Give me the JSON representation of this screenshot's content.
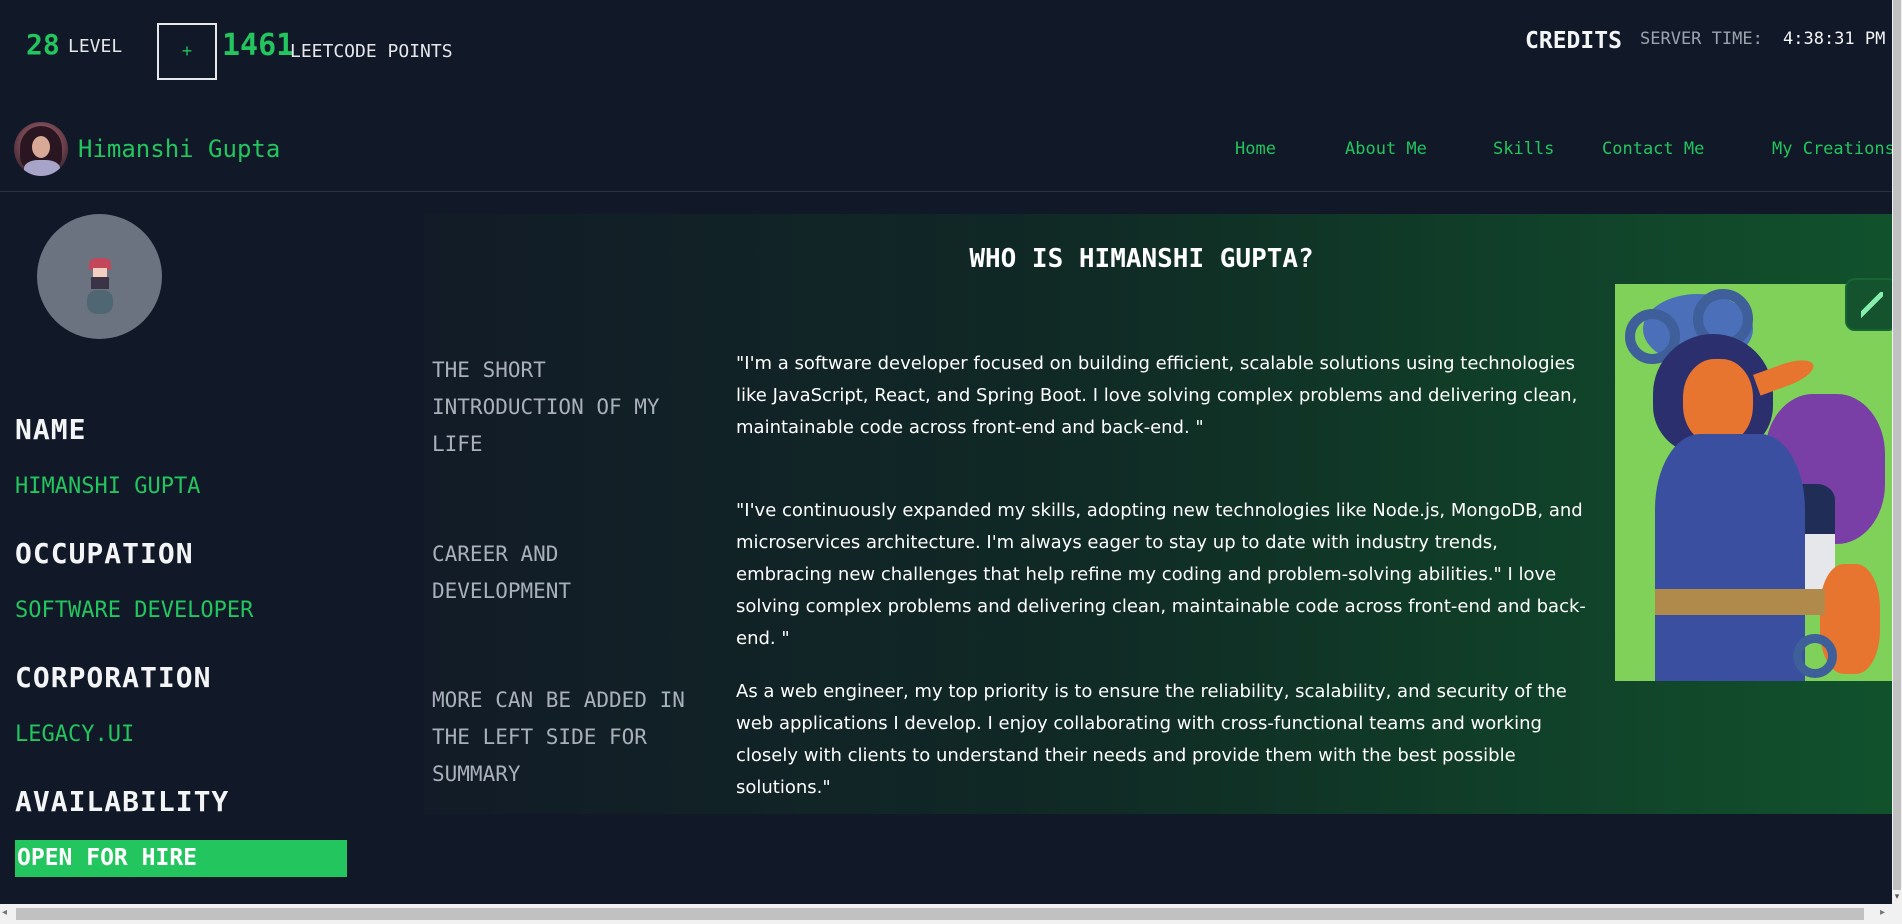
{
  "topbar": {
    "level_value": "28",
    "level_label": "LEVEL",
    "plus_label": "+",
    "points_value": "1461",
    "points_label": "LEETCODE POINTS",
    "credits_label": "CREDITS",
    "server_time_label": "SERVER TIME:",
    "server_time_value": "4:38:31 PM"
  },
  "nav": {
    "brand": "Himanshi Gupta",
    "links": [
      "Home",
      "About Me",
      "Skills",
      "Contact Me",
      "My Creations"
    ]
  },
  "sidebar": {
    "fields": [
      {
        "label": "NAME",
        "value": "HIMANSHI GUPTA"
      },
      {
        "label": "OCCUPATION",
        "value": "SOFTWARE DEVELOPER"
      },
      {
        "label": "CORPORATION",
        "value": "LEGACY.UI"
      },
      {
        "label": "AVAILABILITY",
        "value": "OPEN FOR HIRE"
      }
    ]
  },
  "main": {
    "title": "WHO IS HIMANSHI GUPTA?",
    "sections": [
      {
        "label": "THE SHORT INTRODUCTION OF MY LIFE",
        "text": "\"I'm a software developer focused on building efficient, scalable solutions using technologies like JavaScript, React, and Spring Boot. I love solving complex problems and delivering clean, maintainable code across front-end and back-end. \""
      },
      {
        "label": "CAREER AND DEVELOPMENT",
        "text": "\"I've continuously expanded my skills, adopting new technologies like Node.js, MongoDB, and microservices architecture. I'm always eager to stay up to date with industry trends, embracing new challenges that help refine my coding and problem-solving abilities.\" I love solving complex problems and delivering clean, maintainable code across front-end and back-end. \""
      },
      {
        "label": "MORE CAN BE ADDED IN THE LEFT SIDE FOR SUMMARY",
        "text": "As a web engineer, my top priority is to ensure the reliability, scalability, and security of the web applications I develop. I enjoy collaborating with cross-functional teams and working closely with clients to understand their needs and provide them with the best possible solutions.\""
      }
    ]
  },
  "colors": {
    "background": "#111827",
    "accent": "#22c55e",
    "text": "#e5e7eb"
  },
  "icons": {
    "side_widget": "bolt-icon",
    "plus": "plus-icon"
  }
}
